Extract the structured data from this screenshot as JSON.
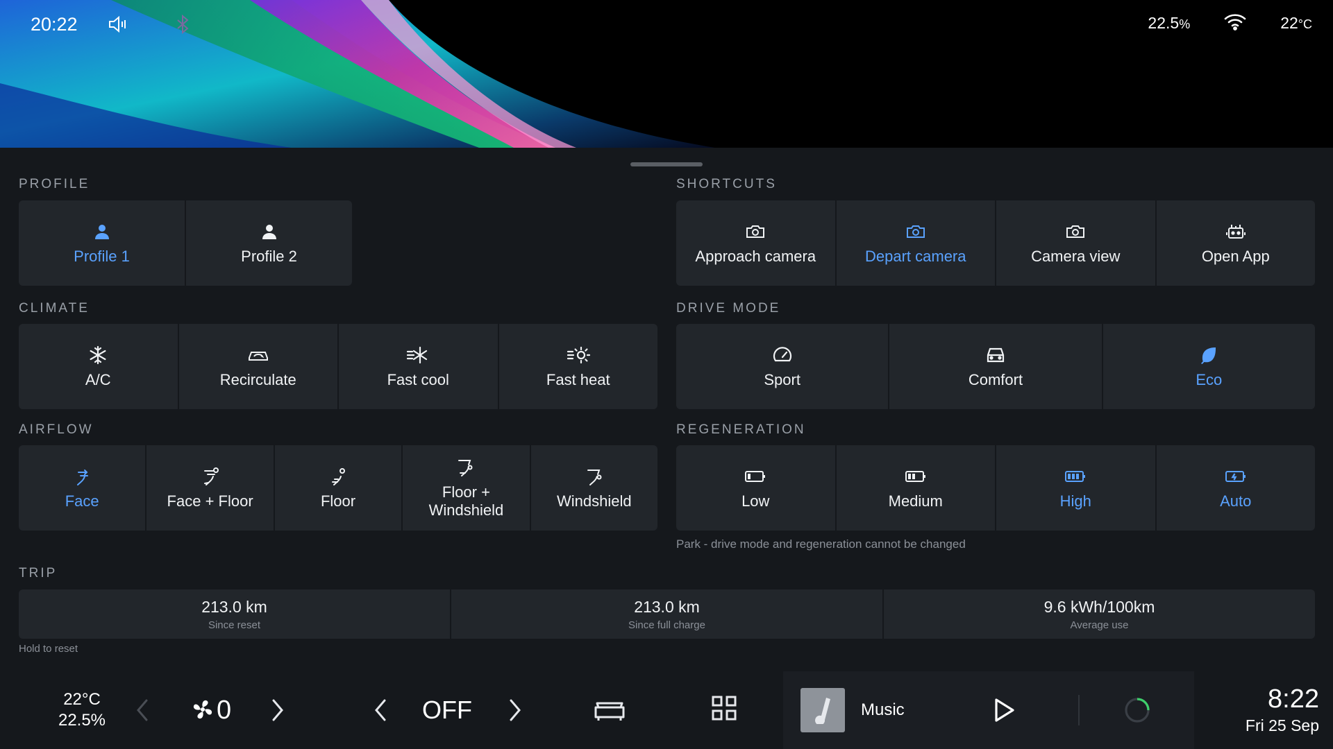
{
  "status": {
    "time": "20:22",
    "icons": [
      "volume-mute-icon",
      "bluetooth-icon",
      "wifi-icon"
    ],
    "humidity": "22.5",
    "humidity_unit": "%",
    "temperature": "22",
    "temperature_unit": "°C"
  },
  "sections": {
    "profile": "PROFILE",
    "shortcuts": "SHORTCUTS",
    "climate": "CLIMATE",
    "drive_mode": "DRIVE MODE",
    "airflow": "AIRFLOW",
    "regeneration": "REGENERATION",
    "trip": "TRIP"
  },
  "profile": [
    {
      "label": "Profile 1",
      "icon": "person-icon",
      "active": true
    },
    {
      "label": "Profile 2",
      "icon": "person-icon",
      "active": false
    }
  ],
  "shortcuts": [
    {
      "label": "Approach camera",
      "icon": "camera-icon",
      "active": false
    },
    {
      "label": "Depart camera",
      "icon": "camera-icon",
      "active": true
    },
    {
      "label": "Camera view",
      "icon": "camera-icon",
      "active": false
    },
    {
      "label": "Open App",
      "icon": "robot-icon",
      "active": false
    }
  ],
  "climate": [
    {
      "label": "A/C",
      "icon": "snowflake-icon"
    },
    {
      "label": "Recirculate",
      "icon": "recirculate-icon"
    },
    {
      "label": "Fast cool",
      "icon": "fast-cool-icon"
    },
    {
      "label": "Fast heat",
      "icon": "fast-heat-icon"
    }
  ],
  "drive_mode": [
    {
      "label": "Sport",
      "icon": "speedometer-icon",
      "active": false
    },
    {
      "label": "Comfort",
      "icon": "car-icon",
      "active": false
    },
    {
      "label": "Eco",
      "icon": "leaf-icon",
      "active": true
    }
  ],
  "airflow": [
    {
      "label": "Face",
      "icon": "airflow-face-icon",
      "active": true
    },
    {
      "label": "Face + Floor",
      "icon": "airflow-face-floor-icon",
      "active": false
    },
    {
      "label": "Floor",
      "icon": "airflow-floor-icon",
      "active": false
    },
    {
      "label_line1": "Floor +",
      "label_line2": "Windshield",
      "icon": "airflow-floor-windshield-icon",
      "active": false
    },
    {
      "label": "Windshield",
      "icon": "airflow-windshield-icon",
      "active": false
    }
  ],
  "regeneration": [
    {
      "label": "Low",
      "icon": "battery-low-icon",
      "active": false
    },
    {
      "label": "Medium",
      "icon": "battery-medium-icon",
      "active": false
    },
    {
      "label": "High",
      "icon": "battery-high-icon",
      "active": true
    },
    {
      "label": "Auto",
      "icon": "battery-auto-icon",
      "active": true
    }
  ],
  "regeneration_note": "Park - drive mode and regeneration cannot be changed",
  "trip": [
    {
      "value": "213.0 km",
      "label": "Since reset"
    },
    {
      "value": "213.0 km",
      "label": "Since full charge"
    },
    {
      "value": "9.6 kWh/100km",
      "label": "Average use"
    }
  ],
  "trip_hint": "Hold to reset",
  "bottom": {
    "cabin_temp": "22°C",
    "cabin_humidity": "22.5%",
    "fan_speed": "0",
    "ac_state": "OFF",
    "media_label": "Music",
    "clock": "8:22",
    "date": "Fri 25 Sep"
  },
  "colors": {
    "accent": "#5aa2ff",
    "panel": "#15181c",
    "tile": "#22262b",
    "loader": "#3ecf6b"
  }
}
